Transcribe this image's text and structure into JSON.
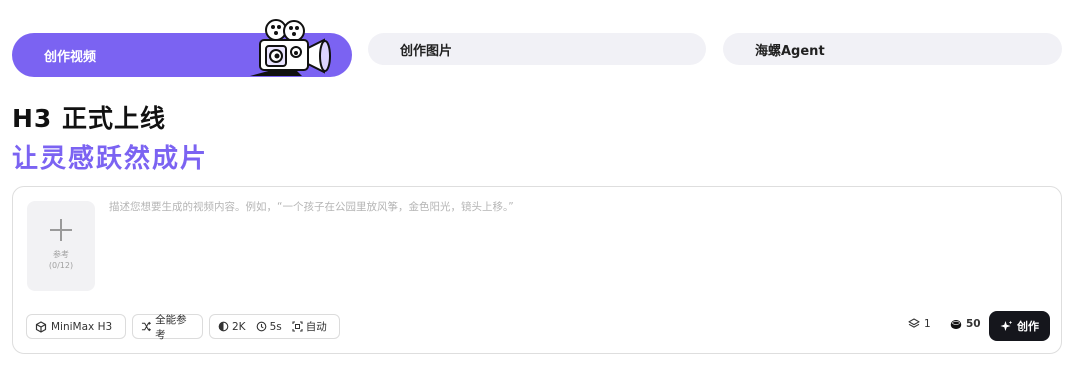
{
  "tabs": [
    {
      "label": "创作视频",
      "active": true
    },
    {
      "label": "创作图片",
      "active": false
    },
    {
      "label": "海螺Agent",
      "active": false
    }
  ],
  "hero": {
    "headline": "H3 正式上线",
    "subline": "让灵感跃然成片"
  },
  "composer": {
    "reference": {
      "label": "参考",
      "count": "(0/12)"
    },
    "prompt_placeholder": "描述您想要生成的视频内容。例如，“一个孩子在公园里放风筝，金色阳光，镜头上移。”",
    "model": "MiniMax H3",
    "reference_mode": "全能参考",
    "resolution": "2K",
    "duration": "5s",
    "ratio": "自动",
    "layers_count": "1",
    "credits": "50",
    "create_label": "创作"
  },
  "colors": {
    "accent": "#7b63f2",
    "tab_bg": "#f1f1f6",
    "create_bg": "#15161c"
  },
  "icons": [
    "camera-mascot",
    "plus-icon",
    "cube-icon",
    "shuffle-icon",
    "aspect-icon",
    "clock-icon",
    "crop-icon",
    "layers-icon",
    "coin-icon",
    "sparkle-icon"
  ]
}
